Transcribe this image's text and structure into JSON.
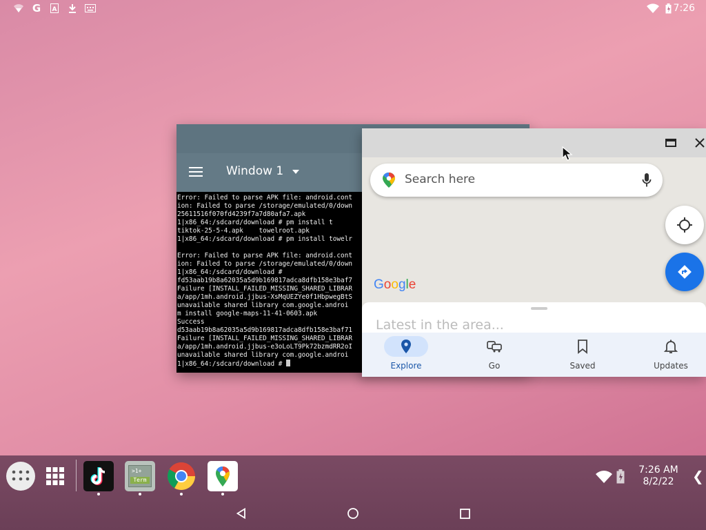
{
  "statusbar": {
    "left_icons": [
      "notification-icon",
      "google-icon",
      "text-icon",
      "download-icon",
      "keyboard-icon"
    ],
    "time": "7:26"
  },
  "terminal": {
    "title": "Window 1",
    "lines": [
      "Error: Failed to parse APK file: android.cont",
      "ion: Failed to parse /storage/emulated/0/down",
      "25611516f070fd4239f7a7d80afa7.apk",
      "1|x86_64:/sdcard/download # pm install t",
      "tiktok-25-5-4.apk    towelroot.apk",
      "1|x86_64:/sdcard/download # pm install towelr",
      "",
      "Error: Failed to parse APK file: android.cont",
      "ion: Failed to parse /storage/emulated/0/down",
      "1|x86_64:/sdcard/download #",
      "fd53aab19b8a62035a5d9b169817adca8dfb158e3baf7",
      "Failure [INSTALL_FAILED_MISSING_SHARED_LIBRAR",
      "a/app/1mh.android.jjbus-XsMqUEZYe0f1HbpwegBtS",
      "unavailable shared library com.google.androi",
      "m install google-maps-11-41-0603.apk",
      "Success",
      "d53aab19b8a62035a5d9b169817adca8dfb158e3baf71",
      "Failure [INSTALL_FAILED_MISSING_SHARED_LIBRAR",
      "a/app/1mh.android.jjbus-e3oLoLT9Pk72bzmdRR2oI",
      "unavailable shared library com.google.androi",
      "1|x86_64:/sdcard/download # "
    ]
  },
  "maps": {
    "search_placeholder": "Search here",
    "google_logo": [
      "G",
      "o",
      "o",
      "g",
      "l",
      "e"
    ],
    "google_colors": [
      "#4285F4",
      "#EA4335",
      "#FBBC05",
      "#4285F4",
      "#34A853",
      "#EA4335"
    ],
    "sheet_title": "Latest in the area...",
    "nav": [
      {
        "label": "Explore",
        "icon": "location-pin-icon",
        "active": true
      },
      {
        "label": "Go",
        "icon": "commute-icon",
        "active": false
      },
      {
        "label": "Saved",
        "icon": "bookmark-icon",
        "active": false
      },
      {
        "label": "Updates",
        "icon": "bell-icon",
        "active": false
      }
    ],
    "accent": "#1a73e8"
  },
  "taskbar": {
    "apps": [
      {
        "name": "TikTok",
        "icon": "tiktok-icon"
      },
      {
        "name": "Term",
        "icon": "terminal-icon",
        "label": ">1+ Term"
      },
      {
        "name": "Chrome",
        "icon": "chrome-icon"
      },
      {
        "name": "Maps",
        "icon": "maps-icon"
      }
    ],
    "clock_time": "7:26 AM",
    "clock_date": "8/2/22"
  }
}
